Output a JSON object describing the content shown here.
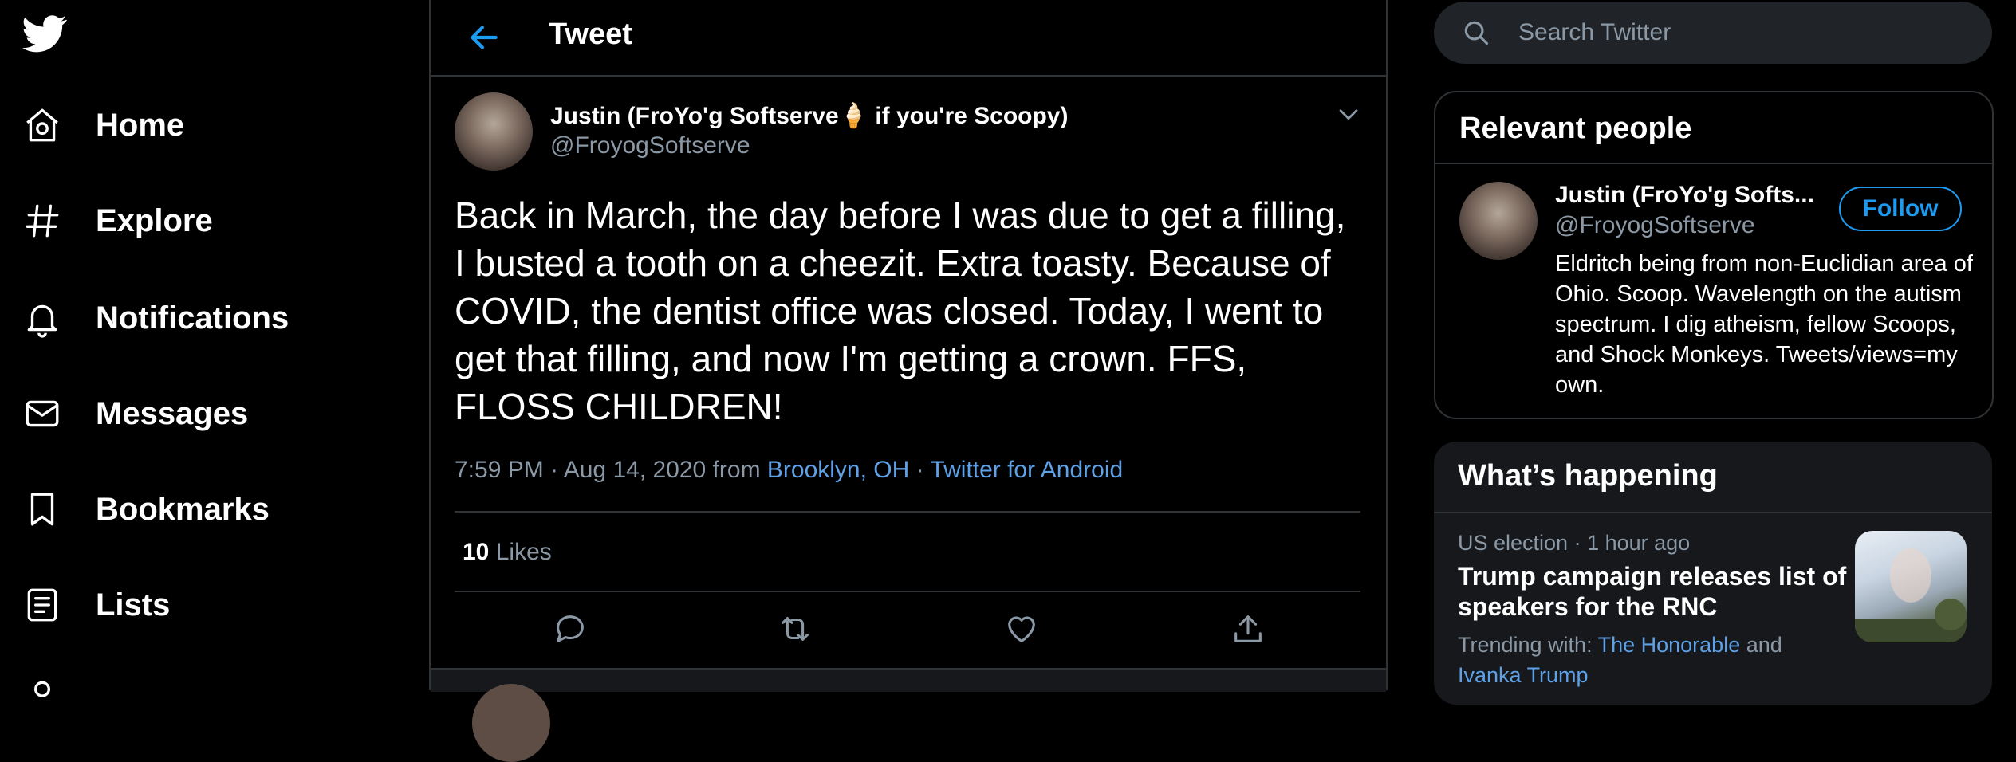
{
  "nav": {
    "items": [
      {
        "label": "Home",
        "icon": "home-icon"
      },
      {
        "label": "Explore",
        "icon": "hashtag-icon"
      },
      {
        "label": "Notifications",
        "icon": "bell-icon"
      },
      {
        "label": "Messages",
        "icon": "envelope-icon"
      },
      {
        "label": "Bookmarks",
        "icon": "bookmark-icon"
      },
      {
        "label": "Lists",
        "icon": "list-icon"
      }
    ]
  },
  "header": {
    "title": "Tweet"
  },
  "tweet": {
    "author_name": "Justin (FroYo'g Softserve🍦 if you're Scoopy)",
    "handle": "@FroyogSoftserve",
    "text": "Back in March, the day before I was due to get a filling, I busted a tooth on a cheezit. Extra toasty. Because of COVID, the dentist office was closed. Today, I went to get that filling, and now I'm getting a crown. FFS, FLOSS CHILDREN!",
    "time": "7:59 PM · Aug 14, 2020 from ",
    "location": "Brooklyn, OH",
    "separator": " · ",
    "source": "Twitter for Android",
    "likes_count": "10",
    "likes_label": "Likes"
  },
  "search": {
    "placeholder": "Search Twitter"
  },
  "relevant_people": {
    "title": "Relevant people",
    "name": "Justin (FroYo'g Softs...",
    "handle": "@FroyogSoftserve",
    "follow_label": "Follow",
    "bio": "Eldritch being from non-Euclidian area of Ohio. Scoop. Wavelength on the autism spectrum. I dig atheism, fellow Scoops, and Shock Monkeys. Tweets/views=my own."
  },
  "whats_happening": {
    "title": "What’s happening",
    "context": "US election · 1 hour ago",
    "trend_title": "Trump campaign releases list of speakers for the RNC",
    "trending_with": "Trending with: ",
    "link1": "The Honorable",
    "and": " and",
    "link2": "Ivanka Trump"
  },
  "colors": {
    "accent": "#1d9bf0",
    "link": "#5ea1e6",
    "muted": "#8b98a5",
    "border": "#2f3336",
    "card": "#16181c"
  }
}
